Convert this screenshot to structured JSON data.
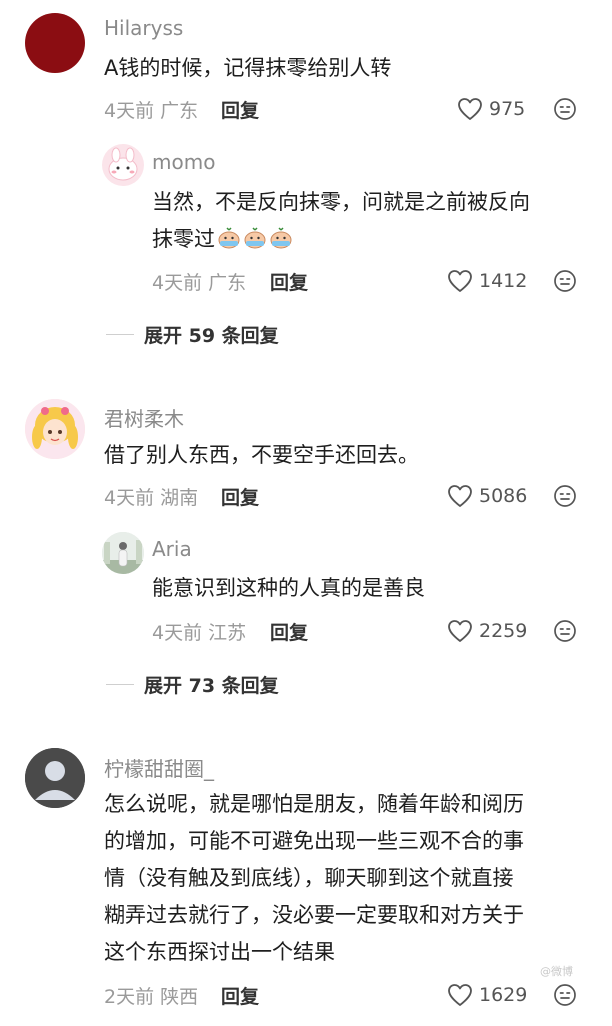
{
  "comments": [
    {
      "username": "Hilaryss",
      "text": [
        "A钱的时候，记得抹零给别人转"
      ],
      "time": "4天前",
      "location": "广东",
      "reply_label": "回复",
      "likes": "975",
      "avatar_color": "#8b0d12",
      "replies": [
        {
          "username": "momo",
          "text": [
            "当然，不是反向抹零，问就是之前被反向",
            "抹零过"
          ],
          "emojis": [
            "crying-face-icon",
            "crying-face-icon",
            "crying-face-icon"
          ],
          "time": "4天前",
          "location": "广东",
          "reply_label": "回复",
          "likes": "1412"
        }
      ],
      "expand_label": "展开 59 条回复"
    },
    {
      "username": "君树柔木",
      "text": [
        "借了别人东西，不要空手还回去。"
      ],
      "time": "4天前",
      "location": "湖南",
      "reply_label": "回复",
      "likes": "5086",
      "replies": [
        {
          "username": "Aria",
          "text": [
            "能意识到这种的人真的是善良"
          ],
          "time": "4天前",
          "location": "江苏",
          "reply_label": "回复",
          "likes": "2259"
        }
      ],
      "expand_label": "展开 73 条回复"
    },
    {
      "username": "柠檬甜甜圈_",
      "text": [
        "怎么说呢，就是哪怕是朋友，随着年龄和阅历",
        "的增加，可能不可避免出现一些三观不合的事",
        "情（没有触及到底线），聊天聊到这个就直接",
        "糊弄过去就行了，没必要一定要取和对方关于",
        "这个东西探讨出一个结果"
      ],
      "time": "2天前",
      "location": "陕西",
      "reply_label": "回复",
      "likes": "1629"
    }
  ],
  "watermark": "@微博"
}
